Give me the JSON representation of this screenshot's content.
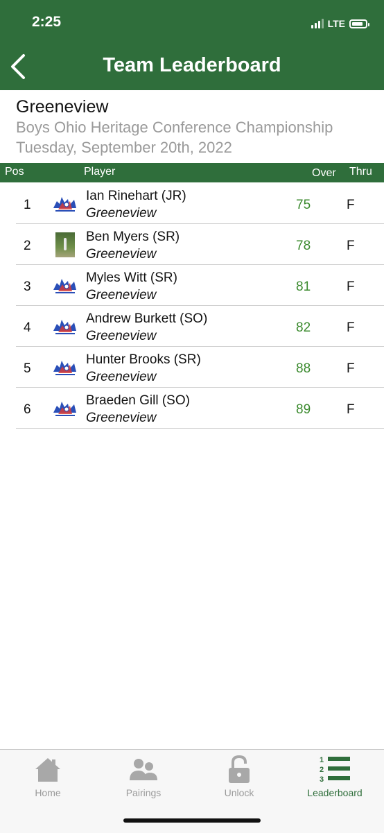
{
  "status": {
    "time": "2:25",
    "network": "LTE"
  },
  "header": {
    "title": "Team Leaderboard"
  },
  "info": {
    "team": "Greeneview",
    "event": "Boys Ohio Heritage Conference Championship",
    "date": "Tuesday, September 20th, 2022"
  },
  "columns": {
    "pos": "Pos",
    "player": "Player",
    "over": "Over",
    "thru": "Thru"
  },
  "rows": [
    {
      "pos": "1",
      "name": "Ian Rinehart (JR)",
      "team": "Greeneview",
      "score": "75",
      "thru": "F",
      "avatar": "team-logo"
    },
    {
      "pos": "2",
      "name": "Ben Myers (SR)",
      "team": "Greeneview",
      "score": "78",
      "thru": "F",
      "avatar": "player-photo"
    },
    {
      "pos": "3",
      "name": "Myles Witt (SR)",
      "team": "Greeneview",
      "score": "81",
      "thru": "F",
      "avatar": "team-logo"
    },
    {
      "pos": "4",
      "name": "Andrew Burkett (SO)",
      "team": "Greeneview",
      "score": "82",
      "thru": "F",
      "avatar": "team-logo"
    },
    {
      "pos": "5",
      "name": "Hunter  Brooks (SR)",
      "team": "Greeneview",
      "score": "88",
      "thru": "F",
      "avatar": "team-logo"
    },
    {
      "pos": "6",
      "name": "Braeden  Gill  (SO)",
      "team": "Greeneview",
      "score": "89",
      "thru": "F",
      "avatar": "team-logo"
    }
  ],
  "tabs": [
    {
      "label": "Home",
      "icon": "home-icon",
      "active": false
    },
    {
      "label": "Pairings",
      "icon": "people-icon",
      "active": false
    },
    {
      "label": "Unlock",
      "icon": "unlock-icon",
      "active": false
    },
    {
      "label": "Leaderboard",
      "icon": "leaderboard-icon",
      "active": true
    }
  ],
  "colors": {
    "brand_green": "#2f6e3b",
    "score_green": "#3b8a2e",
    "muted_gray": "#9a9a9a"
  }
}
